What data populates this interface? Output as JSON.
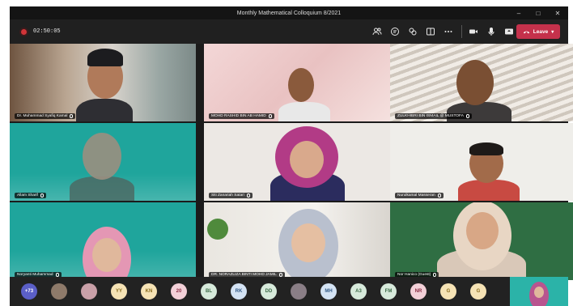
{
  "window": {
    "title": "Monthly Mathematical Colloquium 8/2021",
    "controls": [
      "–",
      "□",
      "✕"
    ]
  },
  "toolbar": {
    "timer": "02:50:05",
    "leave_label": "Leave"
  },
  "tiles": [
    {
      "name": "Dr. Muhammad Syafiq Kamal",
      "bg": "office"
    },
    {
      "name": "MOHD RASHID BIN AB HAMID",
      "bg": "pink"
    },
    {
      "name": "ZULKHIBRI BIN ISMAIL @ MUSTOFA",
      "bg": "blinds"
    },
    {
      "name": "Allam Sharif",
      "bg": "teal"
    },
    {
      "name": "Siti Zanariah Satari",
      "bg": "white"
    },
    {
      "name": "Nurulkamal Masseran",
      "bg": "white"
    },
    {
      "name": "Noryanti Muhammad",
      "bg": "teal"
    },
    {
      "name": "DR. NORAZLIZA BINTI MOHD JAMIL",
      "bg": "plant"
    },
    {
      "name": "Nor Hanico (Guest)",
      "bg": "green"
    }
  ],
  "roster": [
    {
      "text": "+73",
      "color": "#5b5fc7",
      "fg": "#ffffff",
      "kind": "count"
    },
    {
      "text": "",
      "color": "#8e7a6a",
      "fg": "#ffffff",
      "kind": "photo"
    },
    {
      "text": "",
      "color": "#c9a0a8",
      "fg": "#ffffff",
      "kind": "photo"
    },
    {
      "text": "YY",
      "color": "#f6e3b5",
      "fg": "#8a6d1f",
      "kind": "initials"
    },
    {
      "text": "KN",
      "color": "#f6e3b5",
      "fg": "#8a6d1f",
      "kind": "initials"
    },
    {
      "text": "20",
      "color": "#f3d0d8",
      "fg": "#8b2c44",
      "kind": "initials"
    },
    {
      "text": "BL",
      "color": "#d7eadb",
      "fg": "#3d6b48",
      "kind": "initials"
    },
    {
      "text": "RK",
      "color": "#d4e3f4",
      "fg": "#345b87",
      "kind": "initials"
    },
    {
      "text": "DD",
      "color": "#d7eadb",
      "fg": "#3d6b48",
      "kind": "initials"
    },
    {
      "text": "",
      "color": "#8a7e86",
      "fg": "#ffffff",
      "kind": "photo"
    },
    {
      "text": "MH",
      "color": "#d4e3f4",
      "fg": "#345b87",
      "kind": "initials"
    },
    {
      "text": "A3",
      "color": "#d7eadb",
      "fg": "#3d6b48",
      "kind": "initials"
    },
    {
      "text": "FM",
      "color": "#d7eadb",
      "fg": "#3d6b48",
      "kind": "initials"
    },
    {
      "text": "NR",
      "color": "#f3d0d8",
      "fg": "#8b2c44",
      "kind": "initials"
    },
    {
      "text": "G",
      "color": "#f6e3b5",
      "fg": "#8a6d1f",
      "kind": "initials"
    },
    {
      "text": "G",
      "color": "#f6e3b5",
      "fg": "#8a6d1f",
      "kind": "initials"
    }
  ]
}
